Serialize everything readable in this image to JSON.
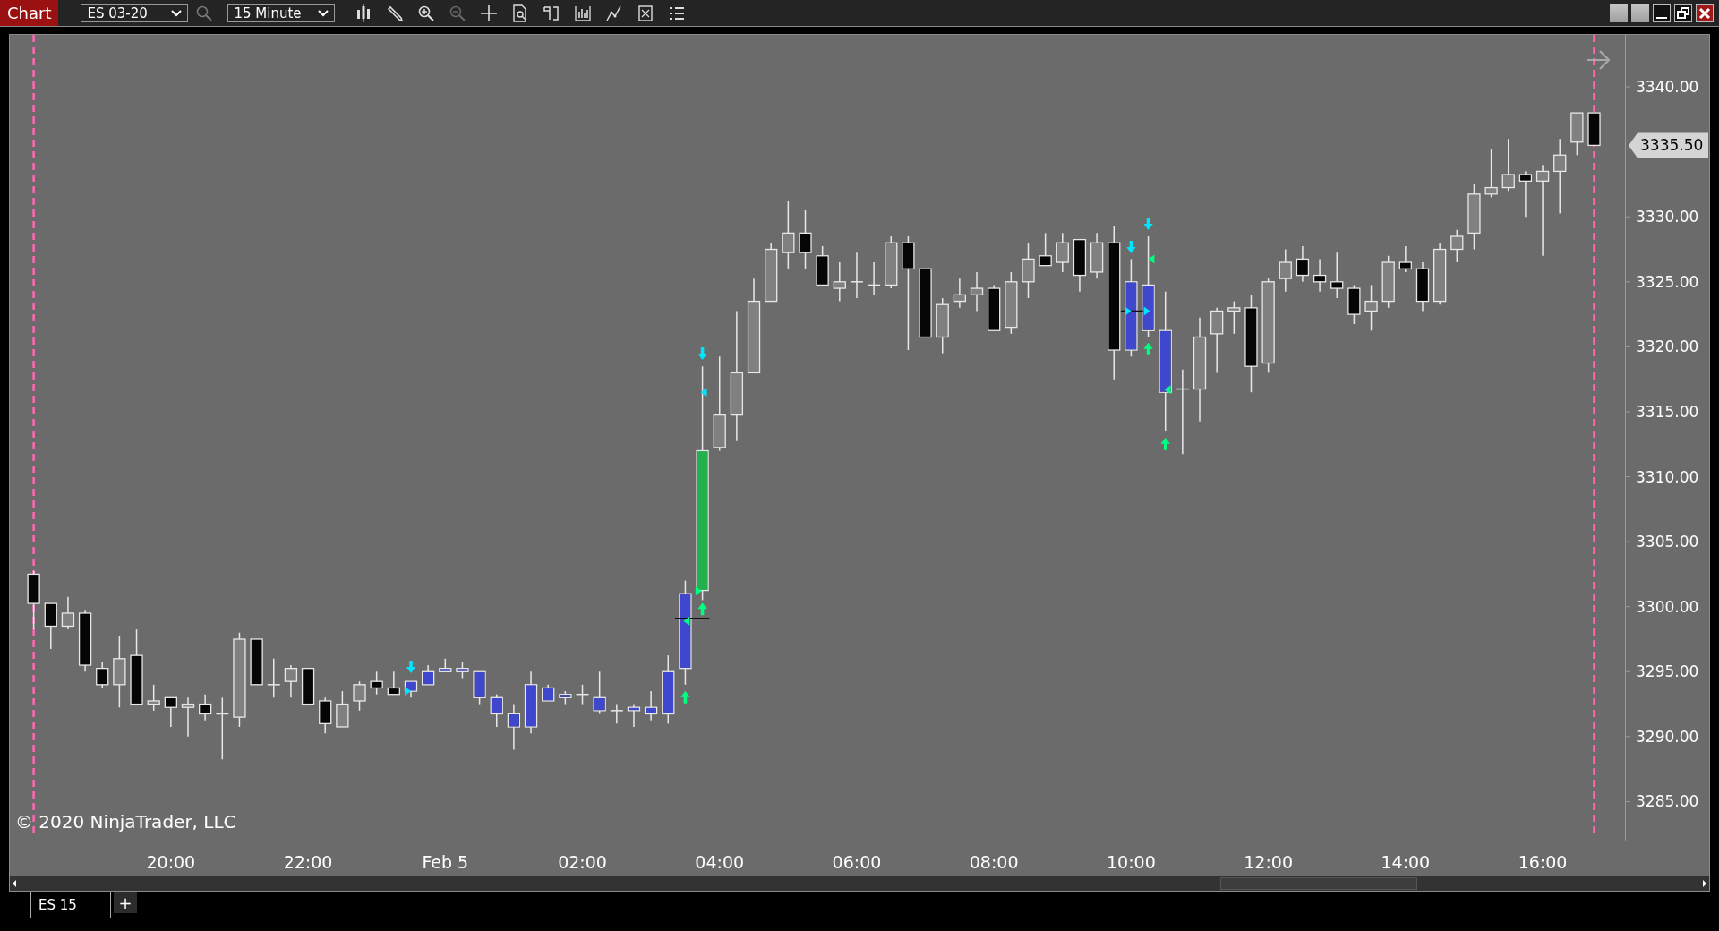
{
  "window": {
    "title": "Chart"
  },
  "toolbar": {
    "instrument": "ES 03-20",
    "interval": "15 Minute"
  },
  "chart": {
    "copyright": "© 2020 NinjaTrader, LLC",
    "last_price": "3335.50",
    "chart_data": {
      "type": "candlestick",
      "ylim": [
        3282,
        3344
      ],
      "yticks": [
        {
          "value": 3285,
          "label": "3285.00"
        },
        {
          "value": 3290,
          "label": "3290.00"
        },
        {
          "value": 3295,
          "label": "3295.00"
        },
        {
          "value": 3300,
          "label": "3300.00"
        },
        {
          "value": 3305,
          "label": "3305.00"
        },
        {
          "value": 3310,
          "label": "3310.00"
        },
        {
          "value": 3315,
          "label": "3315.00"
        },
        {
          "value": 3320,
          "label": "3320.00"
        },
        {
          "value": 3325,
          "label": "3325.00"
        },
        {
          "value": 3330,
          "label": "3330.00"
        },
        {
          "value": 3340,
          "label": "3340.00"
        }
      ],
      "categories": [
        null,
        null,
        null,
        null,
        null,
        null,
        null,
        null,
        "20:00",
        null,
        null,
        null,
        null,
        null,
        null,
        null,
        "22:00",
        null,
        null,
        null,
        null,
        null,
        null,
        null,
        "Feb 5",
        null,
        null,
        null,
        null,
        null,
        null,
        null,
        "02:00",
        null,
        null,
        null,
        null,
        null,
        null,
        null,
        "04:00",
        null,
        null,
        null,
        null,
        null,
        null,
        null,
        "06:00",
        null,
        null,
        null,
        null,
        null,
        null,
        null,
        "08:00",
        null,
        null,
        null,
        null,
        null,
        null,
        null,
        "10:00",
        null,
        null,
        null,
        null,
        null,
        null,
        null,
        "12:00",
        null,
        null,
        null,
        null,
        null,
        null,
        null,
        "14:00",
        null,
        null,
        null,
        null,
        null,
        null,
        null,
        "16:00",
        null,
        null,
        null
      ],
      "ohlc": [
        [
          3302.5,
          3302.75,
          3298.25,
          3300.25
        ],
        [
          3300.25,
          3300.25,
          3296.75,
          3298.5
        ],
        [
          3298.5,
          3300.75,
          3298.25,
          3299.5
        ],
        [
          3299.5,
          3299.75,
          3295,
          3295.5
        ],
        [
          3295.25,
          3295.75,
          3293.75,
          3294
        ],
        [
          3294,
          3297.75,
          3292.25,
          3296
        ],
        [
          3296.25,
          3298.25,
          3292.5,
          3292.5
        ],
        [
          3292.5,
          3294,
          3292,
          3292.75
        ],
        [
          3293,
          3293,
          3290.75,
          3292.25
        ],
        [
          3292.25,
          3293,
          3290,
          3292.5
        ],
        [
          3292.5,
          3293.25,
          3291.25,
          3291.75
        ],
        [
          3291.75,
          3293,
          3288.25,
          3291.75
        ],
        [
          3291.5,
          3298,
          3290.75,
          3297.5
        ],
        [
          3297.5,
          3297.5,
          3294,
          3294
        ],
        [
          3294,
          3296,
          3293,
          3294
        ],
        [
          3294.25,
          3295.5,
          3293,
          3295.25
        ],
        [
          3295.25,
          3295.25,
          3292.5,
          3292.5
        ],
        [
          3292.75,
          3293,
          3290.25,
          3291
        ],
        [
          3290.75,
          3293.5,
          3290.75,
          3292.5
        ],
        [
          3292.75,
          3294.25,
          3292,
          3294
        ],
        [
          3294.25,
          3295,
          3293.25,
          3293.75
        ],
        [
          3293.75,
          3295,
          3293.25,
          3293.25
        ],
        [
          3293.5,
          3294.25,
          3293,
          3294.25
        ],
        [
          3294,
          3295.5,
          3294,
          3295
        ],
        [
          3295,
          3296,
          3295,
          3295.25
        ],
        [
          3295,
          3295.75,
          3294.5,
          3295.25
        ],
        [
          3295,
          3295,
          3292.5,
          3293
        ],
        [
          3293,
          3293.25,
          3290.75,
          3291.75
        ],
        [
          3291.75,
          3292.5,
          3289,
          3290.75
        ],
        [
          3290.75,
          3295,
          3290.25,
          3294
        ],
        [
          3292.75,
          3294,
          3292.75,
          3293.75
        ],
        [
          3293.25,
          3293.5,
          3292.5,
          3293
        ],
        [
          3293.25,
          3294,
          3292.5,
          3293.25
        ],
        [
          3293,
          3295,
          3291.75,
          3292
        ],
        [
          3292,
          3292.5,
          3291,
          3292
        ],
        [
          3292,
          3292.5,
          3290.75,
          3292.25
        ],
        [
          3291.75,
          3293.5,
          3291.25,
          3292.25
        ],
        [
          3291.75,
          3296.25,
          3291,
          3295
        ],
        [
          3295.25,
          3302,
          3294,
          3301
        ],
        [
          3301.25,
          3318.5,
          3300.5,
          3312
        ],
        [
          3312.25,
          3319.25,
          3312,
          3314.75
        ],
        [
          3314.75,
          3322.75,
          3312.75,
          3318
        ],
        [
          3318,
          3325.25,
          3318,
          3323.5
        ],
        [
          3323.5,
          3328,
          3323.5,
          3327.5
        ],
        [
          3327.25,
          3331.25,
          3326,
          3328.75
        ],
        [
          3328.75,
          3330.5,
          3326,
          3327.25
        ],
        [
          3327,
          3327.75,
          3324.75,
          3324.75
        ],
        [
          3324.5,
          3326.5,
          3323.5,
          3325
        ],
        [
          3325,
          3327.25,
          3323.75,
          3325
        ],
        [
          3324.75,
          3326.5,
          3324,
          3324.75
        ],
        [
          3324.75,
          3328.5,
          3324.5,
          3328
        ],
        [
          3328,
          3328.5,
          3319.75,
          3326
        ],
        [
          3326,
          3326,
          3320.75,
          3320.75
        ],
        [
          3320.75,
          3323.75,
          3319.5,
          3323.25
        ],
        [
          3323.5,
          3325.25,
          3323,
          3324
        ],
        [
          3324,
          3325.75,
          3322.75,
          3324.5
        ],
        [
          3324.5,
          3324.75,
          3321.25,
          3321.25
        ],
        [
          3321.5,
          3325.75,
          3321,
          3325
        ],
        [
          3325,
          3328,
          3323.75,
          3326.75
        ],
        [
          3327,
          3328.75,
          3326.25,
          3326.25
        ],
        [
          3326.5,
          3328.75,
          3325.75,
          3328
        ],
        [
          3328.25,
          3328.25,
          3324.25,
          3325.5
        ],
        [
          3325.75,
          3328.75,
          3325.25,
          3328
        ],
        [
          3328,
          3329.25,
          3317.5,
          3319.75
        ],
        [
          3319.75,
          3326.75,
          3319.25,
          3325
        ],
        [
          3324.75,
          3328.5,
          3320.75,
          3321.25
        ],
        [
          3321.25,
          3324.25,
          3313.5,
          3316.5
        ],
        [
          3316.75,
          3318.25,
          3311.75,
          3316.75
        ],
        [
          3316.75,
          3322.25,
          3314.25,
          3320.75
        ],
        [
          3321,
          3323,
          3318,
          3322.75
        ],
        [
          3322.75,
          3323.5,
          3321,
          3323
        ],
        [
          3323,
          3324,
          3316.5,
          3318.5
        ],
        [
          3318.75,
          3325.25,
          3318,
          3325
        ],
        [
          3325.25,
          3327.5,
          3324.25,
          3326.5
        ],
        [
          3326.75,
          3327.75,
          3325,
          3325.5
        ],
        [
          3325.5,
          3326.75,
          3324.25,
          3325
        ],
        [
          3325,
          3327.25,
          3323.75,
          3324.5
        ],
        [
          3324.5,
          3324.75,
          3321.75,
          3322.5
        ],
        [
          3322.75,
          3324.75,
          3321.25,
          3323.5
        ],
        [
          3323.5,
          3327,
          3323,
          3326.5
        ],
        [
          3326.5,
          3327.75,
          3325.75,
          3326
        ],
        [
          3326,
          3326.5,
          3322.75,
          3323.5
        ],
        [
          3323.5,
          3328,
          3323.25,
          3327.5
        ],
        [
          3327.5,
          3329,
          3326.5,
          3328.5
        ],
        [
          3328.75,
          3332.5,
          3327.5,
          3331.75
        ],
        [
          3331.75,
          3335.25,
          3331.5,
          3332.25
        ],
        [
          3332.25,
          3336,
          3332,
          3333.25
        ],
        [
          3333.25,
          3333.5,
          3330,
          3332.75
        ],
        [
          3332.75,
          3334,
          3327,
          3333.5
        ],
        [
          3333.5,
          3336,
          3330.25,
          3334.75
        ],
        [
          3335.75,
          3338,
          3334.75,
          3338
        ],
        [
          3338,
          3338,
          3335.5,
          3335.5
        ]
      ]
    }
  },
  "tabs": [
    {
      "label": "ES 15",
      "selected": true
    }
  ],
  "add_tab": "+"
}
